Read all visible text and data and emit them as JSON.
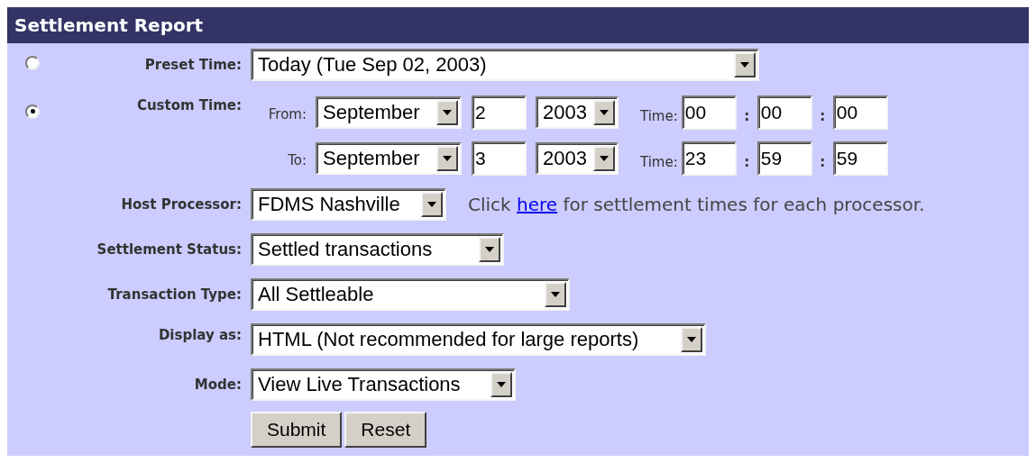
{
  "title": "Settlement Report",
  "preset_time": {
    "selected": false,
    "label": "Preset Time:",
    "value": "Today (Tue Sep 02, 2003)"
  },
  "custom_time": {
    "selected": true,
    "label": "Custom Time:",
    "ranges": [
      {
        "label": "From:",
        "month": "September",
        "day": "2",
        "year": "2003",
        "time_label": "Time:",
        "hour": "00",
        "minute": "00",
        "second": "00",
        "separators": [
          ":",
          ":"
        ]
      },
      {
        "label": "To:",
        "month": "September",
        "day": "3",
        "year": "2003",
        "time_label": "Time:",
        "hour": "23",
        "minute": "59",
        "second": "59",
        "separators": [
          ":",
          ":"
        ]
      }
    ]
  },
  "host_processor": {
    "label": "Host Processor:",
    "value": "FDMS Nashville",
    "note": {
      "before": "Click",
      "link": "here",
      "after": "for settlement times for each processor."
    }
  },
  "fields": [
    {
      "label": "Settlement Status:",
      "value": "Settled transactions"
    },
    {
      "label": "Transaction Type:",
      "value": "All Settleable"
    },
    {
      "label": "Display as:",
      "value": "HTML (Not recommended for large reports)"
    },
    {
      "label": "Mode:",
      "value": "View Live Transactions"
    }
  ],
  "buttons": [
    "Submit",
    "Reset"
  ]
}
